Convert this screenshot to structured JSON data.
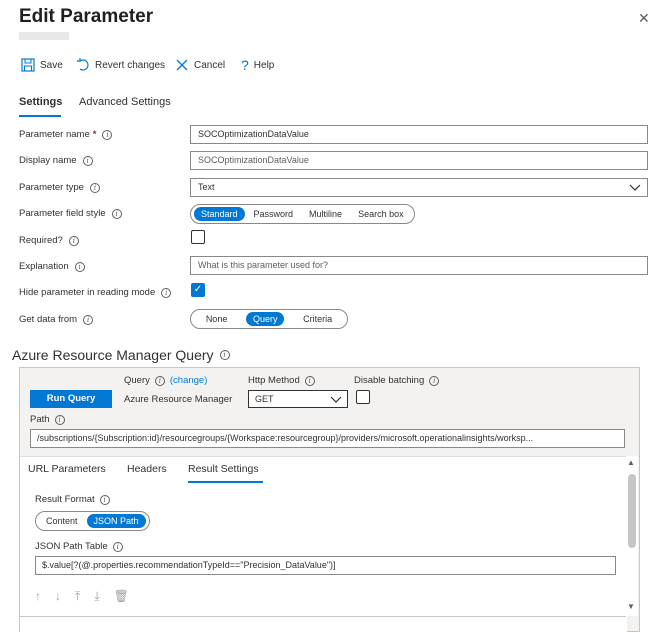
{
  "header": {
    "title": "Edit Parameter"
  },
  "toolbar": {
    "save": "Save",
    "revert": "Revert changes",
    "cancel": "Cancel",
    "help": "Help"
  },
  "tabs": [
    "Settings",
    "Advanced Settings"
  ],
  "form": {
    "parameter_name": {
      "label": "Parameter name",
      "required_mark": "*",
      "value": "SOCOptimizationDataValue"
    },
    "display_name": {
      "label": "Display name",
      "value": "SOCOptimizationDataValue"
    },
    "parameter_type": {
      "label": "Parameter type",
      "value": "Text"
    },
    "field_style": {
      "label": "Parameter field style",
      "options": [
        "Standard",
        "Password",
        "Multiline",
        "Search box"
      ],
      "selected": "Standard"
    },
    "required": {
      "label": "Required?",
      "checked": false
    },
    "explanation": {
      "label": "Explanation",
      "placeholder": "What is this parameter used for?"
    },
    "hide_in_reading": {
      "label": "Hide parameter in reading mode",
      "checked": true
    },
    "get_data_from": {
      "label": "Get data from",
      "options": [
        "None",
        "Query",
        "Criteria"
      ],
      "selected": "Query"
    }
  },
  "arm_query": {
    "heading": "Azure Resource Manager Query",
    "run_query": "Run Query",
    "query_label": "Query",
    "change_link": "(change)",
    "query_source": "Azure Resource Manager",
    "http_method_label": "Http Method",
    "http_method_value": "GET",
    "disable_batching_label": "Disable batching",
    "path_label": "Path",
    "path_value": "/subscriptions/{Subscription:id}/resourcegroups/{Workspace:resourcegroup}/providers/microsoft.operationalinsights/worksp...",
    "inner_tabs": [
      "URL Parameters",
      "Headers",
      "Result Settings"
    ],
    "result_format_label": "Result Format",
    "result_format_options": [
      "Content",
      "JSON Path"
    ],
    "result_format_selected": "JSON Path",
    "json_path_table_label": "JSON Path Table",
    "json_path_table_value": "$.value[?(@.properties.recommendationTypeId==\"Precision_DataValue\")]"
  },
  "colors": {
    "accent": "#0078d4",
    "required": "#a4262c"
  }
}
